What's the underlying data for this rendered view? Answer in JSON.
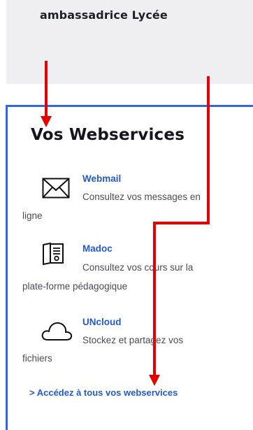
{
  "top_card": {
    "title": "ambassadrice Lycée"
  },
  "webservices": {
    "heading": "Vos Webservices",
    "items": [
      {
        "title": "Webmail",
        "description_line1": "Consultez vos messages en",
        "description_line2": "ligne",
        "icon": "envelope-icon"
      },
      {
        "title": "Madoc",
        "description_line1": "Consultez vos cours sur la",
        "description_line2": "plate-forme pédagogique",
        "icon": "book-icon"
      },
      {
        "title": "UNcloud",
        "description_line1": "Stockez et partagez vos",
        "description_line2": "fichiers",
        "icon": "cloud-icon"
      }
    ],
    "all_link": "> Accédez à tous vos webservices"
  },
  "colors": {
    "panel_border": "#3366e6",
    "link": "#2459cf",
    "annotation_arrow": "#e60000",
    "top_card_background": "#efeff2"
  }
}
